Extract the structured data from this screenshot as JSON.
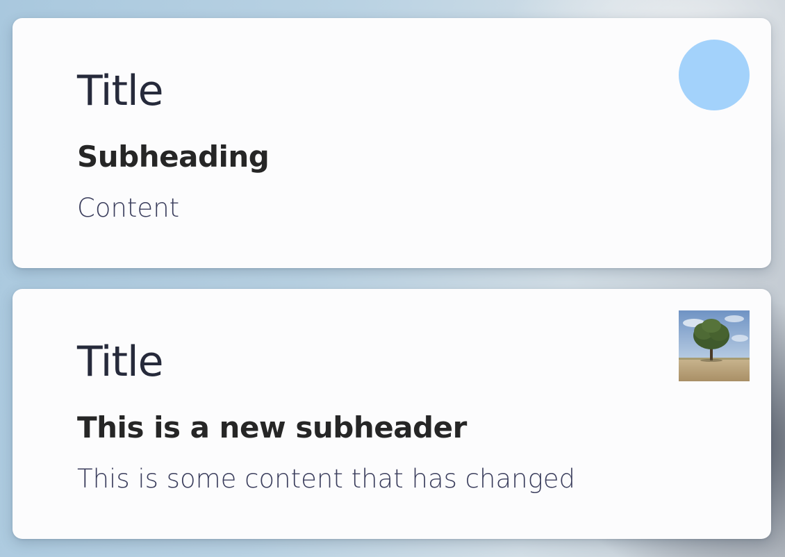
{
  "cards": [
    {
      "title": "Title",
      "subheading": "Subheading",
      "content": "Content",
      "media": "avatar-circle",
      "media_color": "#a3d2fb"
    },
    {
      "title": "Title",
      "subheading": "This is a new subheader",
      "content": "This is some content that has changed",
      "media": "tree-photo-thumbnail"
    }
  ],
  "colors": {
    "card_background": "#fcfcfd",
    "title_text": "#262a3b",
    "subheading_text": "#262626",
    "content_text": "#3a3d5c"
  }
}
